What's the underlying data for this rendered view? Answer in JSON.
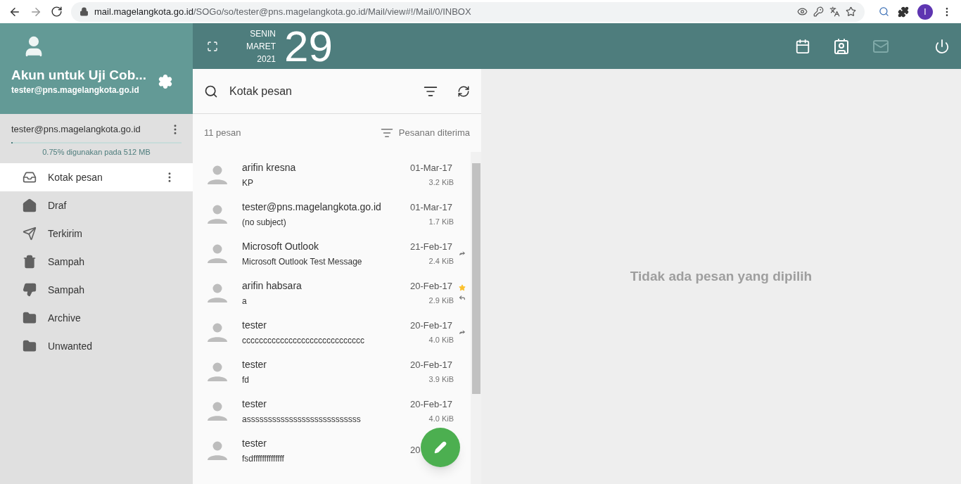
{
  "browser": {
    "url_host": "mail.magelangkota.go.id",
    "url_path": "/SOGo/so/tester@pns.magelangkota.go.id/Mail/view#!/Mail/0/INBOX",
    "profile_initial": "I"
  },
  "account": {
    "name": "Akun untuk Uji Cob...",
    "email": "tester@pns.magelangkota.go.id",
    "mailbox": "tester@pns.magelangkota.go.id",
    "quota_text": "0.75% digunakan pada 512 MB",
    "level": 0.0075
  },
  "date": {
    "weekday": "SENIN",
    "month": "MARET",
    "year": "2021",
    "day": "29"
  },
  "folders": [
    {
      "kind": "inbox",
      "label": "Kotak pesan",
      "selected": true
    },
    {
      "kind": "drafts",
      "label": "Draf",
      "selected": false
    },
    {
      "kind": "sent",
      "label": "Terkirim",
      "selected": false
    },
    {
      "kind": "trash",
      "label": "Sampah",
      "selected": false
    },
    {
      "kind": "junk",
      "label": "Sampah",
      "selected": false
    },
    {
      "kind": "folder",
      "label": "Archive",
      "selected": false
    },
    {
      "kind": "folder",
      "label": "Unwanted",
      "selected": false
    }
  ],
  "search": {
    "value": "Kotak pesan"
  },
  "list_header": {
    "count": "11 pesan",
    "sort": "Pesanan diterima"
  },
  "messages": [
    {
      "sender": "arifin kresna",
      "subject": "KP",
      "date": "01-Mar-17",
      "size": "3.2 KiB",
      "starred": false,
      "forwarded": false,
      "replied": false
    },
    {
      "sender": "tester@pns.magelangkota.go.id",
      "subject": "(no subject)",
      "date": "01-Mar-17",
      "size": "1.7 KiB",
      "starred": false,
      "forwarded": false,
      "replied": false
    },
    {
      "sender": "Microsoft Outlook",
      "subject": "Microsoft Outlook Test Message",
      "date": "21-Feb-17",
      "size": "2.4 KiB",
      "starred": false,
      "forwarded": true,
      "replied": false
    },
    {
      "sender": "arifin habsara",
      "subject": "a",
      "date": "20-Feb-17",
      "size": "2.9 KiB",
      "starred": true,
      "forwarded": false,
      "replied": true
    },
    {
      "sender": "tester",
      "subject": "ccccccccccccccccccccccccccccc",
      "date": "20-Feb-17",
      "size": "4.0 KiB",
      "starred": false,
      "forwarded": true,
      "replied": false
    },
    {
      "sender": "tester",
      "subject": "fd",
      "date": "20-Feb-17",
      "size": "3.9 KiB",
      "starred": false,
      "forwarded": false,
      "replied": false
    },
    {
      "sender": "tester",
      "subject": "asssssssssssssssssssssssssss",
      "date": "20-Feb-17",
      "size": "4.0 KiB",
      "starred": false,
      "forwarded": false,
      "replied": false
    },
    {
      "sender": "tester",
      "subject": "fsdffffffffffffff",
      "date": "20",
      "starred": false,
      "forwarded": false,
      "replied": false
    }
  ],
  "empty_message": "Tidak ada pesan yang dipilih"
}
